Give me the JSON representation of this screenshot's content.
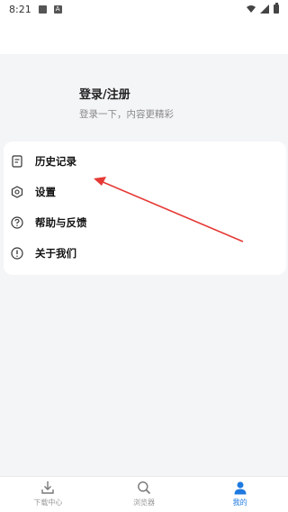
{
  "status_bar": {
    "time": "8:21",
    "notification_badge": "A"
  },
  "profile": {
    "title": "登录/注册",
    "subtitle": "登录一下，内容更精彩"
  },
  "menu": {
    "items": [
      {
        "label": "历史记录",
        "icon": "history-doc-icon"
      },
      {
        "label": "设置",
        "icon": "settings-gear-icon"
      },
      {
        "label": "帮助与反馈",
        "icon": "help-question-icon"
      },
      {
        "label": "关于我们",
        "icon": "info-exclamation-icon"
      }
    ]
  },
  "bottom_nav": {
    "items": [
      {
        "label": "下载中心",
        "icon": "download-icon",
        "active": false
      },
      {
        "label": "浏览器",
        "icon": "search-icon",
        "active": false
      },
      {
        "label": "我的",
        "icon": "user-icon",
        "active": true
      }
    ]
  },
  "colors": {
    "accent": "#1f7ae0",
    "background": "#f4f5f7",
    "annotation_arrow": "#e53935"
  }
}
